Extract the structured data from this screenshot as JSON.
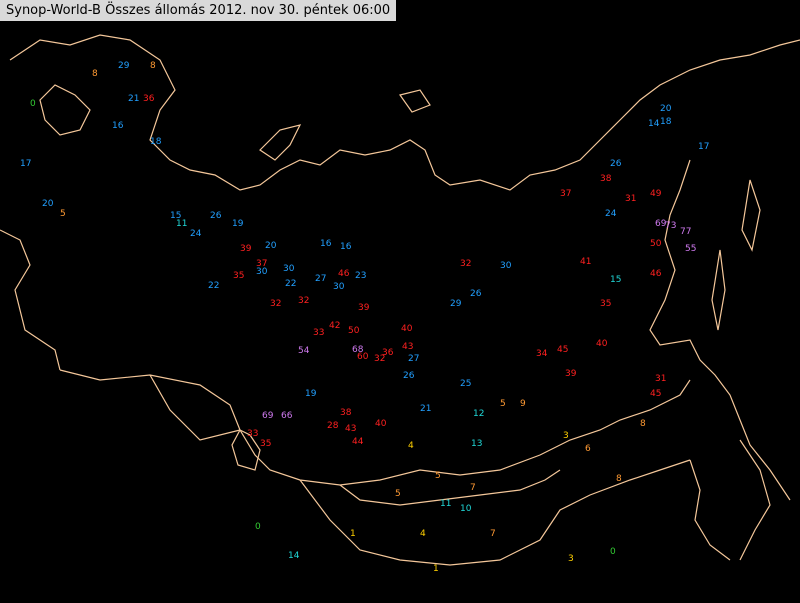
{
  "title": "Synop-World-B Összes állomás 2012. nov 30. péntek 06:00",
  "colors": {
    "background": "#000000",
    "coastline": "#f4c79a",
    "temp_very_cold": "#ff2020",
    "temp_cold": "#22a0ff",
    "temp_mild": "#20d8d8",
    "temp_warm": "#ff9a33",
    "temp_warmer": "#ffd000",
    "temp_zero": "#33cc33",
    "extreme": "#d07af0"
  },
  "stations": [
    {
      "v": "29",
      "c": "temp_cold"
    },
    {
      "v": "8",
      "c": "temp_warm"
    },
    {
      "v": "21",
      "c": "temp_cold"
    },
    {
      "v": "36",
      "c": "temp_very_cold"
    },
    {
      "v": "0",
      "c": "temp_zero"
    },
    {
      "v": "18",
      "c": "temp_cold"
    },
    {
      "v": "16",
      "c": "temp_cold"
    },
    {
      "v": "8",
      "c": "temp_warm"
    },
    {
      "v": "17",
      "c": "temp_cold"
    },
    {
      "v": "20",
      "c": "temp_cold"
    },
    {
      "v": "5",
      "c": "temp_warm"
    },
    {
      "v": "15",
      "c": "temp_cold"
    },
    {
      "v": "11",
      "c": "temp_mild"
    },
    {
      "v": "24",
      "c": "temp_cold"
    },
    {
      "v": "26",
      "c": "temp_cold"
    },
    {
      "v": "19",
      "c": "temp_cold"
    },
    {
      "v": "22",
      "c": "temp_cold"
    },
    {
      "v": "30",
      "c": "temp_cold"
    },
    {
      "v": "20",
      "c": "temp_cold"
    },
    {
      "v": "37",
      "c": "temp_very_cold"
    },
    {
      "v": "30",
      "c": "temp_cold"
    },
    {
      "v": "22",
      "c": "temp_cold"
    },
    {
      "v": "39",
      "c": "temp_very_cold"
    },
    {
      "v": "35",
      "c": "temp_very_cold"
    },
    {
      "v": "16",
      "c": "temp_cold"
    },
    {
      "v": "32",
      "c": "temp_very_cold"
    },
    {
      "v": "32",
      "c": "temp_very_cold"
    },
    {
      "v": "27",
      "c": "temp_cold"
    },
    {
      "v": "16",
      "c": "temp_cold"
    },
    {
      "v": "23",
      "c": "temp_cold"
    },
    {
      "v": "46",
      "c": "temp_very_cold"
    },
    {
      "v": "30",
      "c": "temp_cold"
    },
    {
      "v": "39",
      "c": "temp_very_cold"
    },
    {
      "v": "42",
      "c": "temp_very_cold"
    },
    {
      "v": "50",
      "c": "temp_very_cold"
    },
    {
      "v": "40",
      "c": "temp_very_cold"
    },
    {
      "v": "33",
      "c": "temp_very_cold"
    },
    {
      "v": "43",
      "c": "temp_very_cold"
    },
    {
      "v": "32",
      "c": "temp_very_cold"
    },
    {
      "v": "27",
      "c": "temp_cold"
    },
    {
      "v": "26",
      "c": "temp_cold"
    },
    {
      "v": "68",
      "c": "extreme"
    },
    {
      "v": "54",
      "c": "extreme"
    },
    {
      "v": "60",
      "c": "temp_very_cold"
    },
    {
      "v": "36",
      "c": "temp_very_cold"
    },
    {
      "v": "45",
      "c": "temp_very_cold"
    },
    {
      "v": "34",
      "c": "temp_very_cold"
    },
    {
      "v": "41",
      "c": "temp_very_cold"
    },
    {
      "v": "35",
      "c": "temp_very_cold"
    },
    {
      "v": "32",
      "c": "temp_very_cold"
    },
    {
      "v": "30",
      "c": "temp_cold"
    },
    {
      "v": "26",
      "c": "temp_cold"
    },
    {
      "v": "29",
      "c": "temp_cold"
    },
    {
      "v": "37",
      "c": "temp_very_cold"
    },
    {
      "v": "38",
      "c": "temp_very_cold"
    },
    {
      "v": "31",
      "c": "temp_very_cold"
    },
    {
      "v": "49",
      "c": "temp_very_cold"
    },
    {
      "v": "69",
      "c": "extreme"
    },
    {
      "v": "73",
      "c": "extreme"
    },
    {
      "v": "77",
      "c": "extreme"
    },
    {
      "v": "50",
      "c": "temp_very_cold"
    },
    {
      "v": "55",
      "c": "extreme"
    },
    {
      "v": "46",
      "c": "temp_very_cold"
    },
    {
      "v": "31",
      "c": "temp_very_cold"
    },
    {
      "v": "39",
      "c": "temp_very_cold"
    },
    {
      "v": "40",
      "c": "temp_very_cold"
    },
    {
      "v": "45",
      "c": "temp_very_cold"
    },
    {
      "v": "26",
      "c": "temp_cold"
    },
    {
      "v": "20",
      "c": "temp_cold"
    },
    {
      "v": "14",
      "c": "temp_cold"
    },
    {
      "v": "18",
      "c": "temp_cold"
    },
    {
      "v": "17",
      "c": "temp_cold"
    },
    {
      "v": "24",
      "c": "temp_cold"
    },
    {
      "v": "15",
      "c": "temp_mild"
    },
    {
      "v": "8",
      "c": "temp_warm"
    },
    {
      "v": "6",
      "c": "temp_warm"
    },
    {
      "v": "5",
      "c": "temp_warm"
    },
    {
      "v": "9",
      "c": "temp_warm"
    },
    {
      "v": "4",
      "c": "temp_warmer"
    },
    {
      "v": "1",
      "c": "temp_warmer"
    },
    {
      "v": "0",
      "c": "temp_zero"
    },
    {
      "v": "3",
      "c": "temp_warmer"
    },
    {
      "v": "7",
      "c": "temp_warm"
    },
    {
      "v": "5",
      "c": "temp_warm"
    },
    {
      "v": "11",
      "c": "temp_mild"
    },
    {
      "v": "10",
      "c": "temp_mild"
    },
    {
      "v": "13",
      "c": "temp_mild"
    },
    {
      "v": "12",
      "c": "temp_mild"
    },
    {
      "v": "21",
      "c": "temp_cold"
    },
    {
      "v": "25",
      "c": "temp_cold"
    },
    {
      "v": "19",
      "c": "temp_cold"
    },
    {
      "v": "33",
      "c": "temp_very_cold"
    },
    {
      "v": "35",
      "c": "temp_very_cold"
    },
    {
      "v": "28",
      "c": "temp_very_cold"
    },
    {
      "v": "44",
      "c": "temp_very_cold"
    },
    {
      "v": "69",
      "c": "extreme"
    },
    {
      "v": "66",
      "c": "extreme"
    },
    {
      "v": "38",
      "c": "temp_very_cold"
    },
    {
      "v": "43",
      "c": "temp_very_cold"
    },
    {
      "v": "40",
      "c": "temp_very_cold"
    },
    {
      "v": "5",
      "c": "temp_warm"
    },
    {
      "v": "7",
      "c": "temp_warm"
    },
    {
      "v": "14",
      "c": "temp_mild"
    },
    {
      "v": "1",
      "c": "temp_warmer"
    },
    {
      "v": "4",
      "c": "temp_warmer"
    },
    {
      "v": "0",
      "c": "temp_zero"
    },
    {
      "v": "3",
      "c": "temp_warmer"
    },
    {
      "v": "8",
      "c": "temp_warm"
    }
  ]
}
